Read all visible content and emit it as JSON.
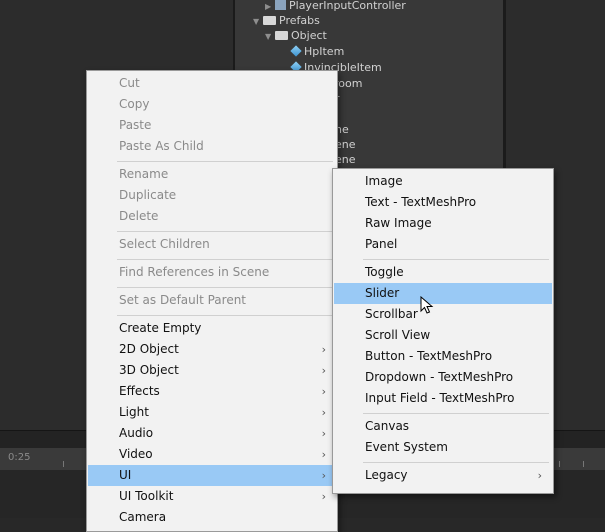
{
  "hierarchy": [
    {
      "label": "PlayerInputController",
      "icon": "script-icon"
    },
    {
      "label": "Prefabs",
      "icon": "folder-icon"
    },
    {
      "label": "Object",
      "icon": "folder-icon"
    },
    {
      "label": "HpItem",
      "icon": "prefab-cube-icon"
    },
    {
      "label": "InvincibleItem",
      "icon": "prefab-cube-icon"
    },
    {
      "label": "room"
    },
    {
      "label": "r"
    },
    {
      "label": "ne"
    },
    {
      "label": "ene"
    },
    {
      "label": "ene"
    }
  ],
  "timeline": {
    "ruler_label": "0:25"
  },
  "context_menu": {
    "items": [
      "Cut",
      "Copy",
      "Paste",
      "Paste As Child",
      "Rename",
      "Duplicate",
      "Delete",
      "Select Children",
      "Find References in Scene",
      "Set as Default Parent",
      "Create Empty",
      "2D Object",
      "3D Object",
      "Effects",
      "Light",
      "Audio",
      "Video",
      "UI",
      "UI Toolkit",
      "Camera"
    ],
    "submenu_arrow": "›"
  },
  "ui_submenu": {
    "items": [
      "Image",
      "Text - TextMeshPro",
      "Raw Image",
      "Panel",
      "Toggle",
      "Slider",
      "Scrollbar",
      "Scroll View",
      "Button - TextMeshPro",
      "Dropdown - TextMeshPro",
      "Input Field - TextMeshPro",
      "Canvas",
      "Event System",
      "Legacy"
    ],
    "highlighted": "Slider"
  },
  "colors": {
    "highlight": "#99c9f5",
    "menu_bg": "#f2f2f2",
    "disabled_text": "#8a8a8a"
  }
}
